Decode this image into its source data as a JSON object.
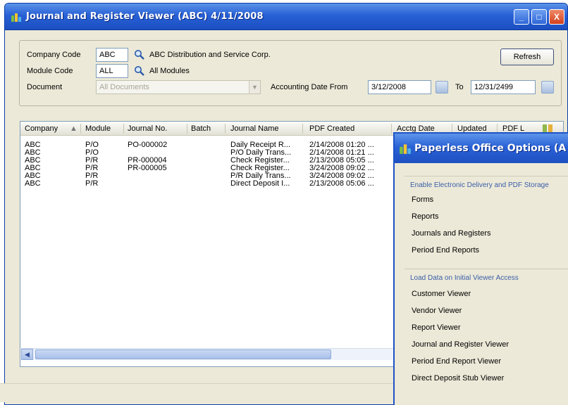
{
  "window": {
    "title": "Journal and Register Viewer (ABC) 4/11/2008",
    "buttons": [
      "_",
      "□",
      "X"
    ]
  },
  "filters": {
    "company_label": "Company Code",
    "company_value": "ABC",
    "company_desc": "ABC Distribution and Service Corp.",
    "module_label": "Module Code",
    "module_value": "ALL",
    "module_desc": "All Modules",
    "document_label": "Document",
    "document_value": "All Documents",
    "date_from_label": "Accounting Date From",
    "date_from_value": "3/12/2008",
    "date_to_label": "To",
    "date_to_value": "12/31/2499",
    "refresh_label": "Refresh"
  },
  "table": {
    "columns": [
      "Company",
      "Module",
      "Journal No.",
      "Batch",
      "Journal Name",
      "PDF Created",
      "Acctg Date",
      "Updated",
      "PDF L"
    ],
    "rows": [
      [
        "ABC",
        "P/O",
        "PO-000002",
        "",
        "Daily Receipt R...",
        "2/14/2008 01:20 ..."
      ],
      [
        "ABC",
        "P/O",
        "",
        "",
        "P/O Daily Trans...",
        "2/14/2008 01:21 ..."
      ],
      [
        "ABC",
        "P/R",
        "PR-000004",
        "",
        "Check Register...",
        "2/13/2008 05:05 ..."
      ],
      [
        "ABC",
        "P/R",
        "PR-000005",
        "",
        "Check Register...",
        "3/24/2008 09:02 ..."
      ],
      [
        "ABC",
        "P/R",
        "",
        "",
        "P/R Daily Trans...",
        "3/24/2008 09:02 ..."
      ],
      [
        "ABC",
        "P/R",
        "",
        "",
        "Direct Deposit I...",
        "2/13/2008 05:06 ..."
      ]
    ]
  },
  "dialog": {
    "title": "Paperless Office Options (A",
    "group1_title": "Enable Electronic Delivery and PDF Storage",
    "group1_items": [
      "Forms",
      "Reports",
      "Journals and Registers",
      "Period End Reports"
    ],
    "group2_title": "Load Data on Initial Viewer Access",
    "group2_items": [
      "Customer Viewer",
      "Vendor Viewer",
      "Report Viewer",
      "Journal and Register Viewer",
      "Period End Report Viewer",
      "Direct Deposit Stub Viewer"
    ]
  },
  "colors": {
    "titlebar": "#2760d6",
    "dialog_border": "#1d52c8",
    "face": "#ece9d8"
  }
}
